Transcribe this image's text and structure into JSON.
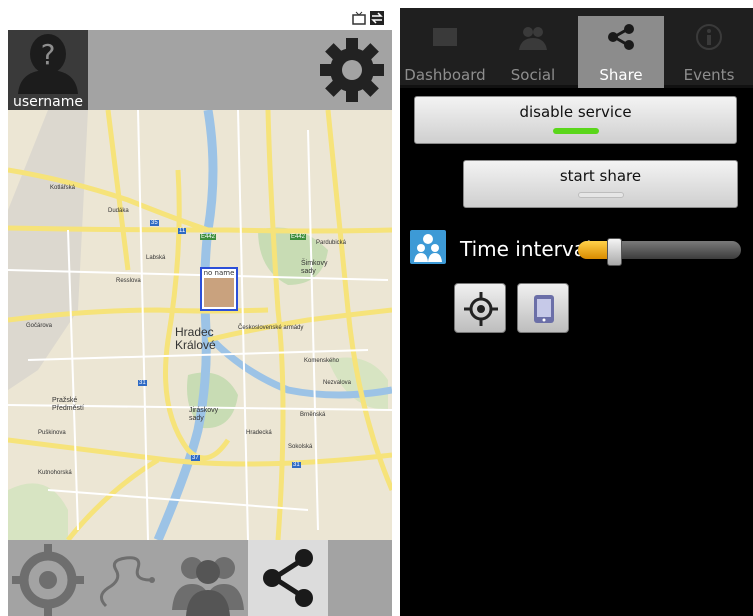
{
  "left_panel": {
    "username": "username",
    "map": {
      "city_label": "Hradec\nKrálové",
      "marker_label": "no name",
      "area_labels": {
        "smetanovy": "Šimkovy\nsady",
        "jiraskovy": "Jiráskovy\nsady",
        "prazske": "Pražské\nPředměstí"
      },
      "street_labels": {
        "kotlarska": "Kotlářská",
        "odafka": "Dudáka",
        "okruzni": "E442",
        "okruzni_right": "E442",
        "labska": "Labská",
        "gocarova": "Gočárova",
        "pardubicka": "Pardubická",
        "ceskoslovenske": "Československé armády",
        "komenskeho": "Komenského",
        "bratri_stefanu": "Nezvalova",
        "sokolska": "Sokolská",
        "hradecka": "Hradecká",
        "brnenska": "Brněnská",
        "puskinova": "Puškinova",
        "kutnohorska": "Kutnohorská",
        "resslova": "Resslova"
      },
      "road_numbers": {
        "r35": "35",
        "r11": "11",
        "r31": "31",
        "r37": "37",
        "r31b": "31"
      }
    },
    "bottom_nav": [
      {
        "name": "locate",
        "active": false
      },
      {
        "name": "route",
        "active": false
      },
      {
        "name": "friends",
        "active": false
      },
      {
        "name": "share",
        "active": true
      }
    ]
  },
  "right_panel": {
    "tabs": [
      {
        "label": "Dashboard",
        "icon": "dashboard-icon",
        "active": false
      },
      {
        "label": "Social",
        "icon": "social-icon",
        "active": false
      },
      {
        "label": "Share",
        "icon": "share-icon",
        "active": true
      },
      {
        "label": "Events",
        "icon": "info-icon",
        "active": false
      }
    ],
    "disable_service": {
      "label": "disable service",
      "indicator": "#5ad61a",
      "on": true
    },
    "start_share": {
      "label": "start share",
      "indicator": "#e6e6e6",
      "on": false
    },
    "time_interval": {
      "label": "Time interval",
      "fraction": 0.18
    },
    "colors": {
      "accent": "#f0a500",
      "indicator_on": "#5ad61a",
      "icon_blue": "#3d9ad6"
    }
  }
}
